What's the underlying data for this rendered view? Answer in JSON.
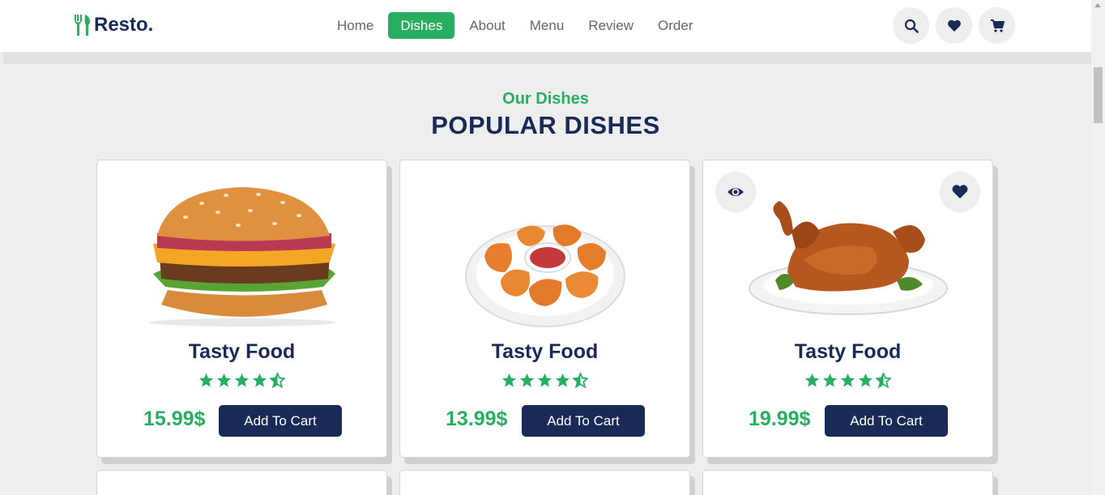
{
  "logo": {
    "text": "Resto."
  },
  "nav": {
    "items": [
      {
        "label": "Home"
      },
      {
        "label": "Dishes"
      },
      {
        "label": "About"
      },
      {
        "label": "Menu"
      },
      {
        "label": "Review"
      },
      {
        "label": "Order"
      }
    ],
    "active": "Dishes"
  },
  "header_icons": [
    "search-icon",
    "heart-icon",
    "cart-icon"
  ],
  "section": {
    "sub_heading": "Our Dishes",
    "heading": "POPULAR DISHES"
  },
  "dishes": [
    {
      "title": "Tasty Food",
      "price": "15.99$",
      "button": "Add To Cart",
      "rating": 4.5,
      "image": "burger"
    },
    {
      "title": "Tasty Food",
      "price": "13.99$",
      "button": "Add To Cart",
      "rating": 4.5,
      "image": "chicken-nuggets"
    },
    {
      "title": "Tasty Food",
      "price": "19.99$",
      "button": "Add To Cart",
      "rating": 4.5,
      "image": "roast-chicken"
    }
  ],
  "colors": {
    "accent": "#27ae60",
    "dark": "#192a56",
    "background": "#eeeeee"
  }
}
